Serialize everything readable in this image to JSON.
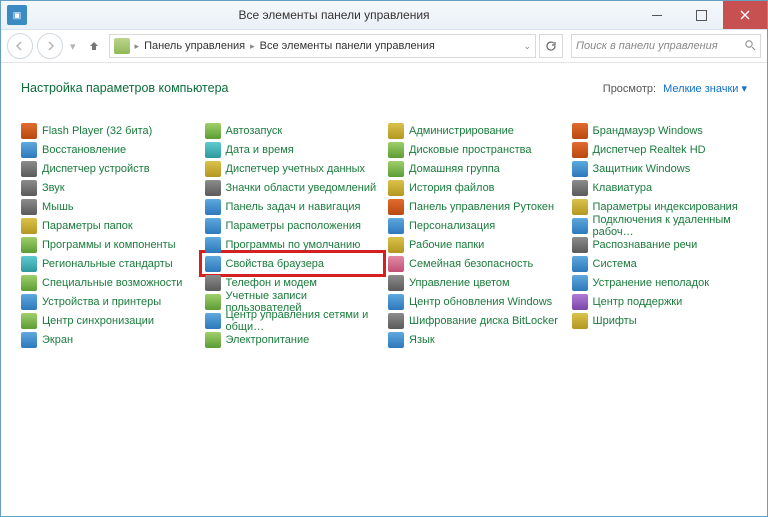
{
  "window": {
    "title": "Все элементы панели управления"
  },
  "nav": {
    "crumb_root": "Панель управления",
    "crumb_current": "Все элементы панели управления"
  },
  "search": {
    "placeholder": "Поиск в панели управления"
  },
  "page": {
    "heading": "Настройка параметров компьютера",
    "view_label": "Просмотр:",
    "view_value": "Мелкие значки"
  },
  "cols": [
    [
      {
        "label": "Flash Player (32 бита)",
        "icon": "flash-icon",
        "c": "c1"
      },
      {
        "label": "Восстановление",
        "icon": "recovery-icon",
        "c": "c2"
      },
      {
        "label": "Диспетчер устройств",
        "icon": "device-manager-icon",
        "c": "c7"
      },
      {
        "label": "Звук",
        "icon": "sound-icon",
        "c": "c7"
      },
      {
        "label": "Мышь",
        "icon": "mouse-icon",
        "c": "c7"
      },
      {
        "label": "Параметры папок",
        "icon": "folder-options-icon",
        "c": "c4"
      },
      {
        "label": "Программы и компоненты",
        "icon": "programs-icon",
        "c": "c3"
      },
      {
        "label": "Региональные стандарты",
        "icon": "region-icon",
        "c": "c8"
      },
      {
        "label": "Специальные возможности",
        "icon": "ease-access-icon",
        "c": "c3"
      },
      {
        "label": "Устройства и принтеры",
        "icon": "devices-icon",
        "c": "c2"
      },
      {
        "label": "Центр синхронизации",
        "icon": "sync-center-icon",
        "c": "c3"
      },
      {
        "label": "Экран",
        "icon": "display-icon",
        "c": "c2"
      }
    ],
    [
      {
        "label": "Автозапуск",
        "icon": "autoplay-icon",
        "c": "c3"
      },
      {
        "label": "Дата и время",
        "icon": "date-time-icon",
        "c": "c8"
      },
      {
        "label": "Диспетчер учетных данных",
        "icon": "cred-manager-icon",
        "c": "c4"
      },
      {
        "label": "Значки области уведомлений",
        "icon": "notification-icons-icon",
        "c": "c7"
      },
      {
        "label": "Панель задач и навигация",
        "icon": "taskbar-icon",
        "c": "c2"
      },
      {
        "label": "Параметры расположения",
        "icon": "location-icon",
        "c": "c2"
      },
      {
        "label": "Программы по умолчанию",
        "icon": "default-programs-icon",
        "c": "c2"
      },
      {
        "label": "Свойства браузера",
        "icon": "internet-options-icon",
        "c": "c2",
        "highlight": true
      },
      {
        "label": "Телефон и модем",
        "icon": "phone-modem-icon",
        "c": "c7"
      },
      {
        "label": "Учетные записи пользователей",
        "icon": "user-accounts-icon",
        "c": "c3"
      },
      {
        "label": "Центр управления сетями и общи…",
        "icon": "network-center-icon",
        "c": "c2"
      },
      {
        "label": "Электропитание",
        "icon": "power-icon",
        "c": "c3"
      }
    ],
    [
      {
        "label": "Администрирование",
        "icon": "admin-tools-icon",
        "c": "c4"
      },
      {
        "label": "Дисковые пространства",
        "icon": "storage-spaces-icon",
        "c": "c3"
      },
      {
        "label": "Домашняя группа",
        "icon": "homegroup-icon",
        "c": "c3"
      },
      {
        "label": "История файлов",
        "icon": "file-history-icon",
        "c": "c4"
      },
      {
        "label": "Панель управления Рутокен",
        "icon": "rutoken-icon",
        "c": "c1"
      },
      {
        "label": "Персонализация",
        "icon": "personalization-icon",
        "c": "c2"
      },
      {
        "label": "Рабочие папки",
        "icon": "work-folders-icon",
        "c": "c4"
      },
      {
        "label": "Семейная безопасность",
        "icon": "family-safety-icon",
        "c": "c6"
      },
      {
        "label": "Управление цветом",
        "icon": "color-mgmt-icon",
        "c": "c7"
      },
      {
        "label": "Центр обновления Windows",
        "icon": "windows-update-icon",
        "c": "c2"
      },
      {
        "label": "Шифрование диска BitLocker",
        "icon": "bitlocker-icon",
        "c": "c7"
      },
      {
        "label": "Язык",
        "icon": "language-icon",
        "c": "c2"
      }
    ],
    [
      {
        "label": "Брандмауэр Windows",
        "icon": "firewall-icon",
        "c": "c1"
      },
      {
        "label": "Диспетчер Realtek HD",
        "icon": "realtek-icon",
        "c": "c1"
      },
      {
        "label": "Защитник Windows",
        "icon": "defender-icon",
        "c": "c2"
      },
      {
        "label": "Клавиатура",
        "icon": "keyboard-icon",
        "c": "c7"
      },
      {
        "label": "Параметры индексирования",
        "icon": "indexing-icon",
        "c": "c4"
      },
      {
        "label": "Подключения к удаленным рабоч…",
        "icon": "remote-app-icon",
        "c": "c2"
      },
      {
        "label": "Распознавание речи",
        "icon": "speech-icon",
        "c": "c7"
      },
      {
        "label": "Система",
        "icon": "system-icon",
        "c": "c2"
      },
      {
        "label": "Устранение неполадок",
        "icon": "troubleshoot-icon",
        "c": "c2"
      },
      {
        "label": "Центр поддержки",
        "icon": "action-center-icon",
        "c": "c5"
      },
      {
        "label": "Шрифты",
        "icon": "fonts-icon",
        "c": "c4"
      }
    ]
  ]
}
